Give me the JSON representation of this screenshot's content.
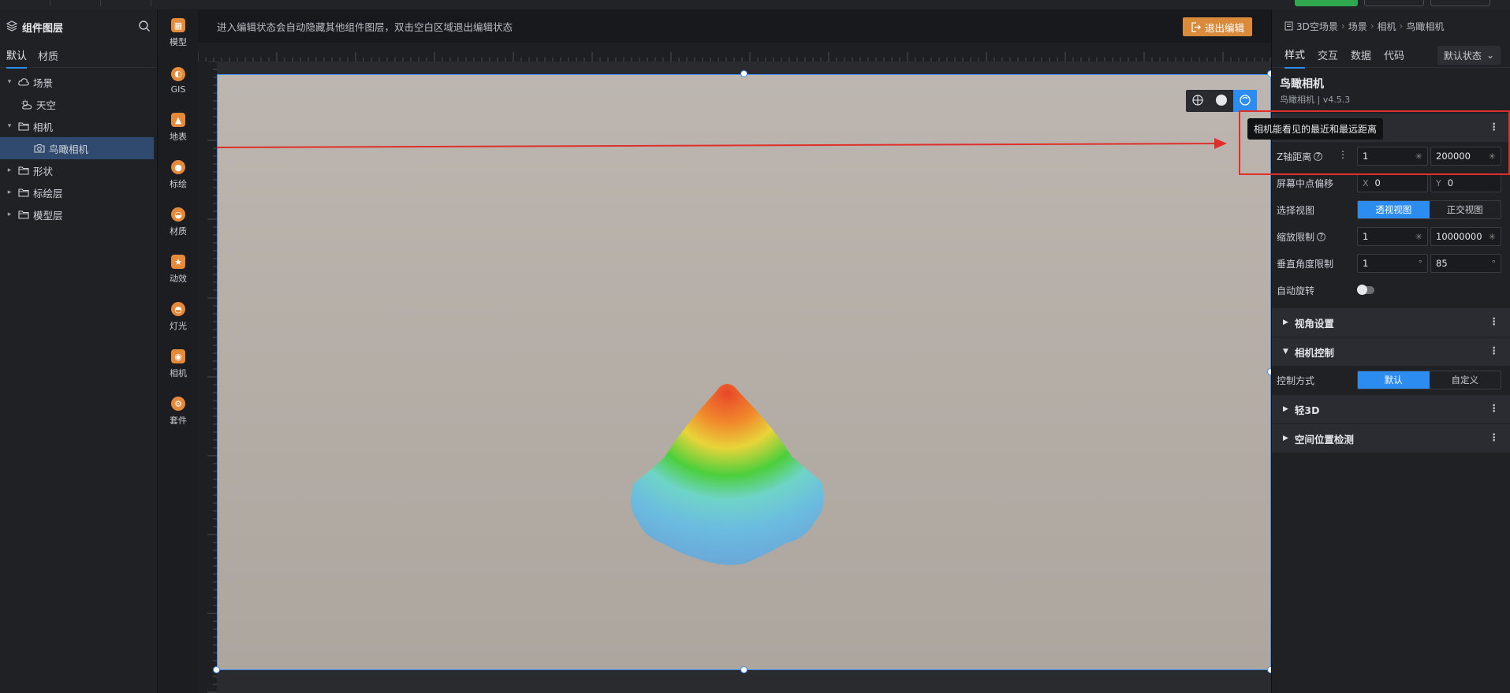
{
  "layers": {
    "title": "组件图层",
    "tabs": [
      "默认",
      "材质"
    ],
    "tree": [
      {
        "label": "场景",
        "depth": 0,
        "caret": "▾",
        "icon": "cloud"
      },
      {
        "label": "天空",
        "depth": 1,
        "caret": "",
        "icon": "sun-cloud"
      },
      {
        "label": "相机",
        "depth": 0,
        "caret": "▾",
        "icon": "folder"
      },
      {
        "label": "鸟瞰相机",
        "depth": 1,
        "caret": "",
        "icon": "camera",
        "selected": true
      },
      {
        "label": "形状",
        "depth": 0,
        "caret": "▸",
        "icon": "folder"
      },
      {
        "label": "标绘层",
        "depth": 0,
        "caret": "▸",
        "icon": "folder"
      },
      {
        "label": "模型层",
        "depth": 0,
        "caret": "▸",
        "icon": "folder"
      }
    ]
  },
  "tools": [
    {
      "label": "模型",
      "icon": "model-icon"
    },
    {
      "label": "GIS",
      "icon": "gis-icon"
    },
    {
      "label": "地表",
      "icon": "terrain-icon"
    },
    {
      "label": "标绘",
      "icon": "marker-icon"
    },
    {
      "label": "材质",
      "icon": "material-icon"
    },
    {
      "label": "动效",
      "icon": "effect-icon"
    },
    {
      "label": "灯光",
      "icon": "light-icon"
    },
    {
      "label": "相机",
      "icon": "camera-icon"
    },
    {
      "label": "套件",
      "icon": "kit-icon"
    }
  ],
  "canvas": {
    "notice": "进入编辑状态会自动隐藏其他组件图层，双击空白区域退出编辑状态",
    "exit_label": "退出编辑"
  },
  "props": {
    "breadcrumbs": [
      "3D空场景",
      "场景",
      "相机",
      "鸟瞰相机"
    ],
    "tabs": [
      "样式",
      "交互",
      "数据",
      "代码"
    ],
    "state": "默认状态",
    "title": "鸟瞰相机",
    "subtitle": "鸟瞰相机 | v4.5.3",
    "tooltip": "相机能看见的最近和最远距离",
    "z_axis": {
      "label": "Z轴距离",
      "min": "1",
      "max": "200000"
    },
    "screen_offset": {
      "label": "屏幕中点偏移",
      "x_prefix": "X",
      "x": "0",
      "y_prefix": "Y",
      "y": "0"
    },
    "view": {
      "label": "选择视图",
      "options": [
        "透视视图",
        "正交视图"
      ],
      "selected": 0
    },
    "zoom": {
      "label": "缩放限制",
      "min": "1",
      "max": "10000000"
    },
    "vertical": {
      "label": "垂直角度限制",
      "min": "1",
      "max": "85",
      "unit": "°"
    },
    "auto_rotate": {
      "label": "自动旋转",
      "on": false
    },
    "sections": {
      "view_settings": "视角设置",
      "camera_control": "相机控制",
      "light3d": "轻3D",
      "space_detect": "空间位置检测"
    },
    "control": {
      "label": "控制方式",
      "options": [
        "默认",
        "自定义"
      ],
      "selected": 0
    }
  }
}
